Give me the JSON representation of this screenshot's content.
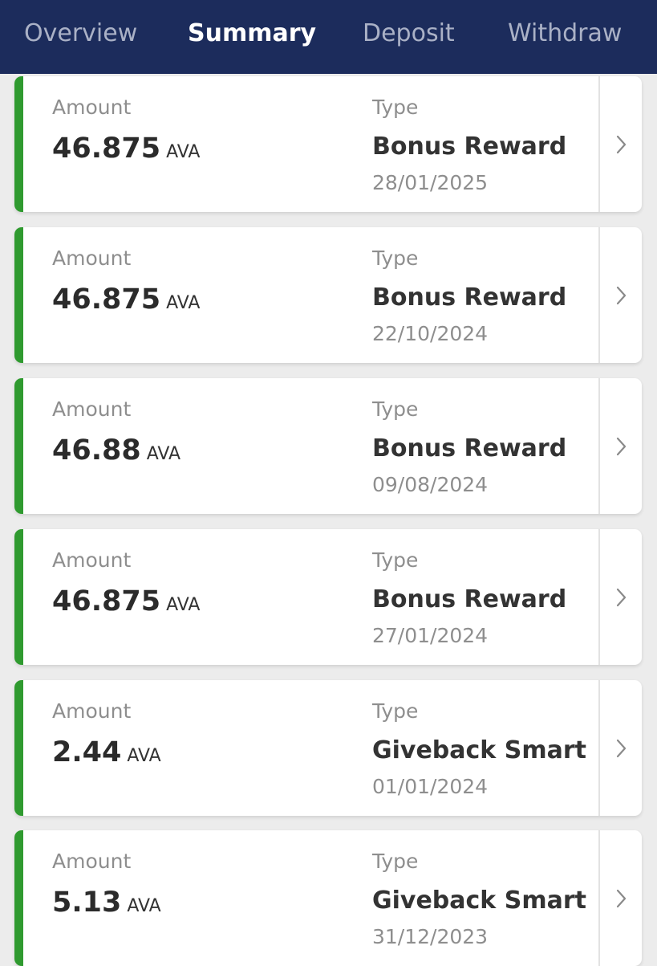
{
  "tabs": [
    {
      "label": "Overview",
      "active": false
    },
    {
      "label": "Summary",
      "active": true
    },
    {
      "label": "Deposit",
      "active": false
    },
    {
      "label": "Withdraw",
      "active": false
    }
  ],
  "colors": {
    "header_bg": "#1c2c5c",
    "accent_green": "#2f9a2f",
    "page_bg": "#ececec"
  },
  "transactions": [
    {
      "amount_label": "Amount",
      "amount": "46.875",
      "unit": "AVA",
      "type_label": "Type",
      "type": "Bonus Reward",
      "date": "28/01/2025",
      "icon": "chevron-right-icon"
    },
    {
      "amount_label": "Amount",
      "amount": "46.875",
      "unit": "AVA",
      "type_label": "Type",
      "type": "Bonus Reward",
      "date": "22/10/2024",
      "icon": "chevron-right-icon"
    },
    {
      "amount_label": "Amount",
      "amount": "46.88",
      "unit": "AVA",
      "type_label": "Type",
      "type": "Bonus Reward",
      "date": "09/08/2024",
      "icon": "chevron-right-icon"
    },
    {
      "amount_label": "Amount",
      "amount": "46.875",
      "unit": "AVA",
      "type_label": "Type",
      "type": "Bonus Reward",
      "date": "27/01/2024",
      "icon": "chevron-right-icon"
    },
    {
      "amount_label": "Amount",
      "amount": "2.44",
      "unit": "AVA",
      "type_label": "Type",
      "type": "Giveback Smart",
      "date": "01/01/2024",
      "icon": "chevron-right-icon"
    },
    {
      "amount_label": "Amount",
      "amount": "5.13",
      "unit": "AVA",
      "type_label": "Type",
      "type": "Giveback Smart",
      "date": "31/12/2023",
      "icon": "chevron-right-icon"
    }
  ]
}
